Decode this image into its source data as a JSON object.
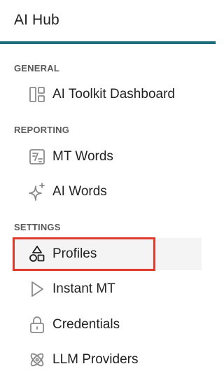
{
  "app": {
    "title": "AI Hub"
  },
  "colors": {
    "accent": "#1a6e7a",
    "highlight": "#e03a2f",
    "active_bg": "#f4f4f4"
  },
  "sections": [
    {
      "label": "GENERAL",
      "items": [
        {
          "label": "AI Toolkit Dashboard",
          "icon": "dashboard-icon",
          "active": false
        }
      ]
    },
    {
      "label": "REPORTING",
      "items": [
        {
          "label": "MT Words",
          "icon": "mt-words-icon",
          "active": false
        },
        {
          "label": "AI Words",
          "icon": "sparkle-icon",
          "active": false
        }
      ]
    },
    {
      "label": "SETTINGS",
      "items": [
        {
          "label": "Profiles",
          "icon": "shapes-icon",
          "active": true
        },
        {
          "label": "Instant MT",
          "icon": "play-icon",
          "active": false
        },
        {
          "label": "Credentials",
          "icon": "lock-icon",
          "active": false
        },
        {
          "label": "LLM Providers",
          "icon": "atom-icon",
          "active": false
        }
      ]
    }
  ]
}
